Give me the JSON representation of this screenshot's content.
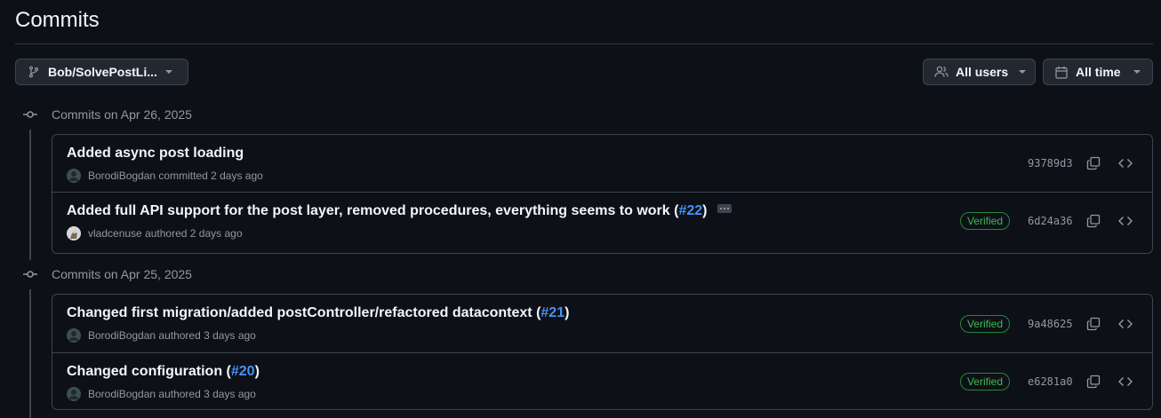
{
  "page": {
    "title": "Commits"
  },
  "filters": {
    "branch": {
      "label": "Bob/SolvePostLi...",
      "icon": "git-branch-icon"
    },
    "users": {
      "label": "All users",
      "icon": "people-icon"
    },
    "time": {
      "label": "All time",
      "icon": "calendar-icon"
    }
  },
  "groups": [
    {
      "label": "Commits on Apr 26, 2025",
      "commits": [
        {
          "message": "Added async post loading",
          "pr": "",
          "has_ellipsis": false,
          "author": "BorodiBogdan",
          "action": "committed",
          "when": "2 days ago",
          "verified": "",
          "sha": "93789d3"
        },
        {
          "message": "Added full API support for the post layer, removed procedures, everything seems to work (",
          "pr": "#22",
          "suffix": ")",
          "has_ellipsis": true,
          "author": "vladcenuse",
          "action": "authored",
          "when": "2 days ago",
          "verified": "Verified",
          "sha": "6d24a36"
        }
      ]
    },
    {
      "label": "Commits on Apr 25, 2025",
      "commits": [
        {
          "message": "Changed first migration/added postController/refactored datacontext (",
          "pr": "#21",
          "suffix": ")",
          "has_ellipsis": false,
          "author": "BorodiBogdan",
          "action": "authored",
          "when": "3 days ago",
          "verified": "Verified",
          "sha": "9a48625"
        },
        {
          "message": "Changed configuration (",
          "pr": "#20",
          "suffix": ")",
          "has_ellipsis": false,
          "author": "BorodiBogdan",
          "action": "authored",
          "when": "3 days ago",
          "verified": "Verified",
          "sha": "e6281a0"
        }
      ]
    }
  ],
  "colors": {
    "background": "#0d1117",
    "border": "#3d444d",
    "link": "#4493f8",
    "verified": "#3fb950",
    "muted": "#9198a1"
  }
}
